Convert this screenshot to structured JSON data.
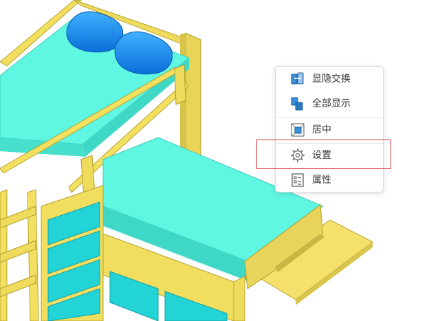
{
  "context_menu": {
    "items": [
      {
        "label": "显隐交换",
        "icon": "show-hide-swap-icon"
      },
      {
        "label": "全部显示",
        "icon": "show-all-icon"
      },
      {
        "label": "居中",
        "icon": "center-view-icon"
      },
      {
        "label": "设置",
        "icon": "gear-icon"
      },
      {
        "label": "属性",
        "icon": "properties-icon"
      }
    ],
    "highlighted_item": "设置"
  },
  "colors": {
    "wood": "#f0dc5a",
    "mattress": "#5cf4e0",
    "pillow": "#0a8ef0",
    "drawer": "#1ec8cc",
    "highlight": "#d9363e"
  }
}
